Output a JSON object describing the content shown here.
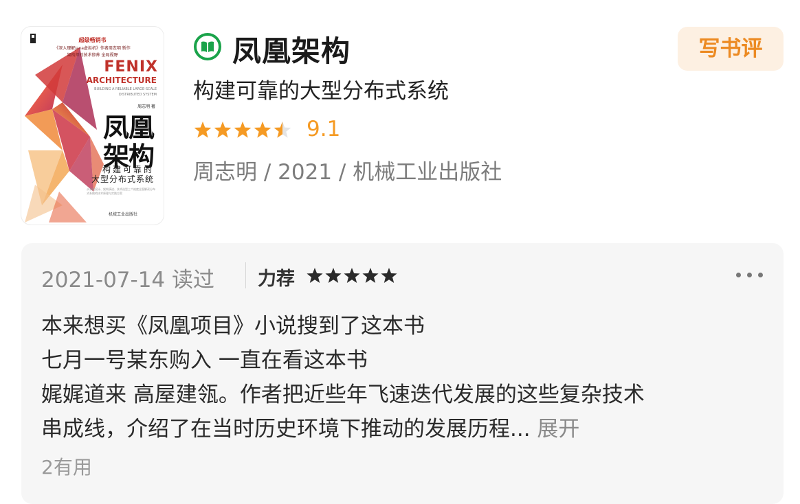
{
  "book": {
    "title": "凤凰架构",
    "subtitle": "构建可靠的大型分布式系统",
    "rating_value": "9.1",
    "rating_stars": 4.5,
    "meta": "周志明 / 2021 / 机械工业出版社",
    "write_review_label": "写书评"
  },
  "cover": {
    "top_line1": "超级畅销书",
    "top_line2": "《深入理解Java虚拟机》作者周志明 新作",
    "top_line3": "架构师的技术修养 全局视野",
    "fenix": "FENIX",
    "architecture": "ARCHITECTURE",
    "sub_line1": "BUILDING A RELIABLE LARGE-SCALE",
    "sub_line2": "DISTRIBUTED SYSTEM",
    "author": "周志明 著",
    "title_line1": "凤凰",
    "title_line2": "架构",
    "tagline1": "构建可靠的",
    "tagline2": "大型分布式系统",
    "blurb": "从系统设计、架构演进、技术选型三个维度全面解读分布式系统的技术原理与实践方案",
    "publisher": "机械工业出版社"
  },
  "review": {
    "date_status": "2021-07-14 读过",
    "recommend_label": "力荐",
    "stars": 5,
    "lines": [
      "本来想买《凤凰项目》小说搜到了这本书",
      "七月一号某东购入 一直在看这本书",
      "娓娓道来 高屋建瓴。作者把近些年飞速迭代发展的这些复杂技术",
      "串成线，介绍了在当时历史环境下推动的发展历程..."
    ],
    "expand_label": "展开",
    "useful_label": "2有用"
  },
  "colors": {
    "accent_orange": "#f59a23",
    "button_bg": "#fdf0e2",
    "button_text": "#ec8a22",
    "read_icon_green": "#1aa34a",
    "cover_red": "#c0322b"
  },
  "icons": {
    "status": "reading-book-icon",
    "more": "more-dots-icon"
  }
}
